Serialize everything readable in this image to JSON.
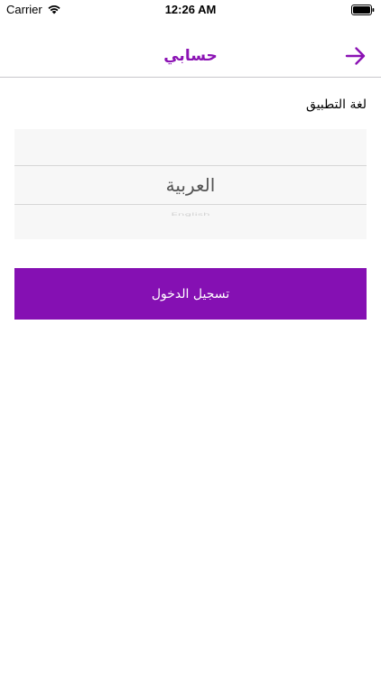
{
  "status_bar": {
    "carrier": "Carrier",
    "time": "12:26 AM",
    "icons": [
      "wifi-icon",
      "battery-icon"
    ]
  },
  "nav": {
    "title": "حسابي",
    "back_icon": "arrow-right-icon"
  },
  "language": {
    "label": "لغة التطبيق",
    "selected": "العربية",
    "below": "English"
  },
  "login": {
    "label": "تسجيل الدخول"
  },
  "colors": {
    "accent": "#8b12b4",
    "button": "#8510b3",
    "picker_bg": "#f7f7f7",
    "divider": "#c8c7cc"
  }
}
